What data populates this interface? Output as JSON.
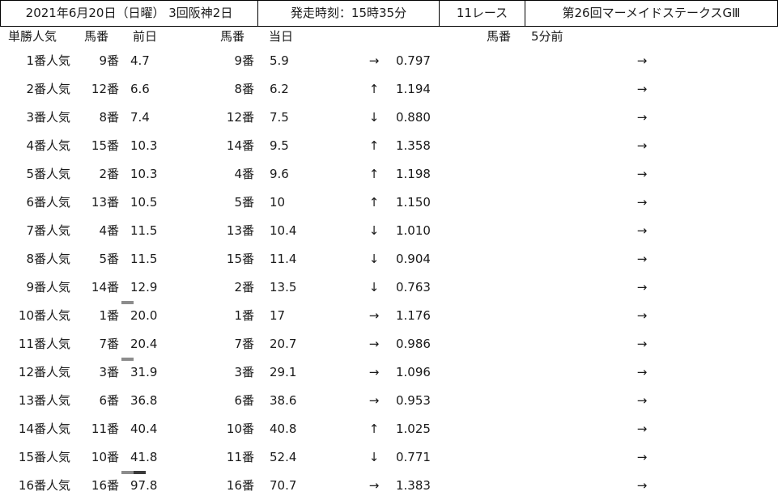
{
  "header": {
    "date_venue": "2021年6月20日（日曜） 3回阪神2日",
    "post_time": "発走時刻：15時35分",
    "race_no": "11レース",
    "race_name": "第26回マーメイドステークスGⅢ"
  },
  "subheader": {
    "popularity": "単勝人気",
    "horse_no_prev": "馬番",
    "prev_day": "前日",
    "horse_no_today": "馬番",
    "today": "当日",
    "horse_no_5min": "馬番",
    "five_min_before": "5分前"
  },
  "colors": {
    "arrow": "#1a1a1a",
    "bar_light": "#8c8c8c",
    "bar_dark": "#3a3a3a"
  },
  "rows": [
    {
      "rank": "1番人気",
      "prev_no": "9番",
      "prev_odds": "4.7",
      "today_no": "9番",
      "today_odds": "5.9",
      "arrow": "→",
      "ratio": "0.797",
      "arrow5": "→"
    },
    {
      "rank": "2番人気",
      "prev_no": "12番",
      "prev_odds": "6.6",
      "today_no": "8番",
      "today_odds": "6.2",
      "arrow": "↑",
      "ratio": "1.194",
      "arrow5": "→"
    },
    {
      "rank": "3番人気",
      "prev_no": "8番",
      "prev_odds": "7.4",
      "today_no": "12番",
      "today_odds": "7.5",
      "arrow": "↓",
      "ratio": "0.880",
      "arrow5": "→"
    },
    {
      "rank": "4番人気",
      "prev_no": "15番",
      "prev_odds": "10.3",
      "today_no": "14番",
      "today_odds": "9.5",
      "arrow": "↑",
      "ratio": "1.358",
      "arrow5": "→"
    },
    {
      "rank": "5番人気",
      "prev_no": "2番",
      "prev_odds": "10.3",
      "today_no": "4番",
      "today_odds": "9.6",
      "arrow": "↑",
      "ratio": "1.198",
      "arrow5": "→"
    },
    {
      "rank": "6番人気",
      "prev_no": "13番",
      "prev_odds": "10.5",
      "today_no": "5番",
      "today_odds": "10",
      "arrow": "↑",
      "ratio": "1.150",
      "arrow5": "→"
    },
    {
      "rank": "7番人気",
      "prev_no": "4番",
      "prev_odds": "11.5",
      "today_no": "13番",
      "today_odds": "10.4",
      "arrow": "↓",
      "ratio": "1.010",
      "arrow5": "→"
    },
    {
      "rank": "8番人気",
      "prev_no": "5番",
      "prev_odds": "11.5",
      "today_no": "15番",
      "today_odds": "11.4",
      "arrow": "↓",
      "ratio": "0.904",
      "arrow5": "→"
    },
    {
      "rank": "9番人気",
      "prev_no": "14番",
      "prev_odds": "12.9",
      "today_no": "2番",
      "today_odds": "13.5",
      "arrow": "↓",
      "ratio": "0.763",
      "arrow5": "→"
    },
    {
      "rank": "10番人気",
      "prev_no": "1番",
      "prev_odds": "20.0",
      "today_no": "1番",
      "today_odds": "17",
      "arrow": "→",
      "ratio": "1.176",
      "arrow5": "→"
    },
    {
      "rank": "11番人気",
      "prev_no": "7番",
      "prev_odds": "20.4",
      "today_no": "7番",
      "today_odds": "20.7",
      "arrow": "→",
      "ratio": "0.986",
      "arrow5": "→"
    },
    {
      "rank": "12番人気",
      "prev_no": "3番",
      "prev_odds": "31.9",
      "today_no": "3番",
      "today_odds": "29.1",
      "arrow": "→",
      "ratio": "1.096",
      "arrow5": "→"
    },
    {
      "rank": "13番人気",
      "prev_no": "6番",
      "prev_odds": "36.8",
      "today_no": "6番",
      "today_odds": "38.6",
      "arrow": "→",
      "ratio": "0.953",
      "arrow5": "→"
    },
    {
      "rank": "14番人気",
      "prev_no": "11番",
      "prev_odds": "40.4",
      "today_no": "10番",
      "today_odds": "40.8",
      "arrow": "↑",
      "ratio": "1.025",
      "arrow5": "→"
    },
    {
      "rank": "15番人気",
      "prev_no": "10番",
      "prev_odds": "41.8",
      "today_no": "11番",
      "today_odds": "52.4",
      "arrow": "↓",
      "ratio": "0.771",
      "arrow5": "→"
    },
    {
      "rank": "16番人気",
      "prev_no": "16番",
      "prev_odds": "97.8",
      "today_no": "16番",
      "today_odds": "70.7",
      "arrow": "→",
      "ratio": "1.383",
      "arrow5": "→"
    }
  ]
}
